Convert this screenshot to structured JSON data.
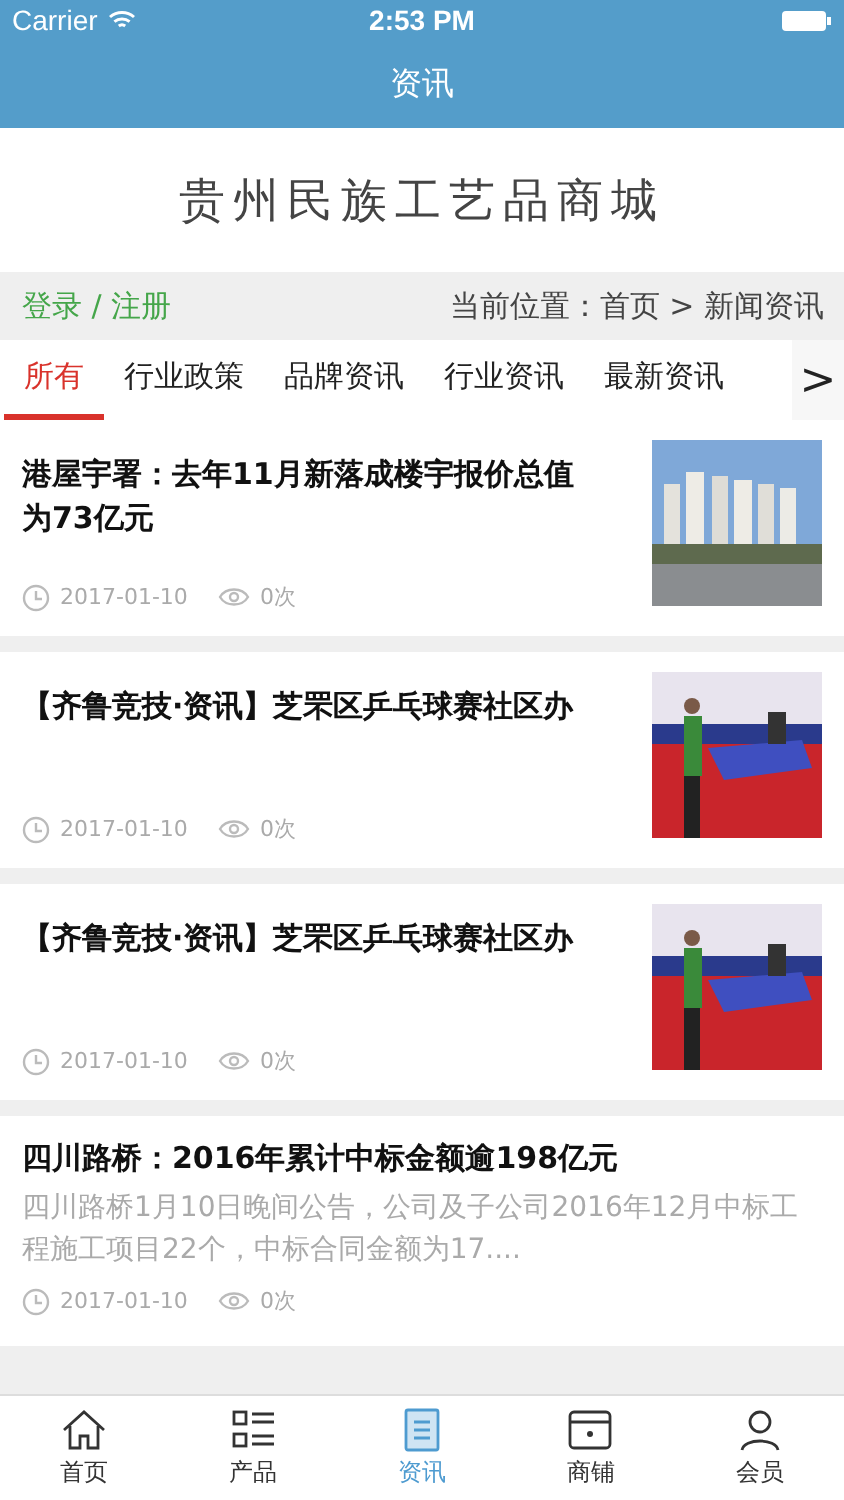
{
  "status_bar": {
    "carrier": "Carrier",
    "time": "2:53 PM"
  },
  "nav": {
    "title": "资讯"
  },
  "header": {
    "logo": "贵州民族工艺品商城"
  },
  "user_bar": {
    "login": "登录 / 注册",
    "breadcrumb": "当前位置：首页 > 新闻资讯"
  },
  "tabs": [
    {
      "label": "所有",
      "selected": true
    },
    {
      "label": "行业政策",
      "selected": false
    },
    {
      "label": "品牌资讯",
      "selected": false
    },
    {
      "label": "行业资讯",
      "selected": false
    },
    {
      "label": "最新资讯",
      "selected": false
    }
  ],
  "tabs_more": ">",
  "articles": [
    {
      "title": "港屋宇署：去年11月新落成楼宇报价总值为73亿元",
      "date": "2017-01-10",
      "views": "0次"
    },
    {
      "title": "【齐鲁竞技·资讯】芝罘区乒乓球赛社区办",
      "date": "2017-01-10",
      "views": "0次"
    },
    {
      "title": "【齐鲁竞技·资讯】芝罘区乒乓球赛社区办",
      "date": "2017-01-10",
      "views": "0次"
    },
    {
      "kind": "summary",
      "title": "四川路桥：2016年累计中标金额逾198亿元",
      "summary": "四川路桥1月10日晚间公告，公司及子公司2016年12月中标工程施工项目22个，中标合同金额为17....",
      "date": "2017-01-10",
      "views": "0次"
    }
  ],
  "tab_bar": [
    {
      "label": "首页",
      "selected": false
    },
    {
      "label": "产品",
      "selected": false
    },
    {
      "label": "资讯",
      "selected": true
    },
    {
      "label": "商铺",
      "selected": false
    },
    {
      "label": "会员",
      "selected": false
    }
  ]
}
